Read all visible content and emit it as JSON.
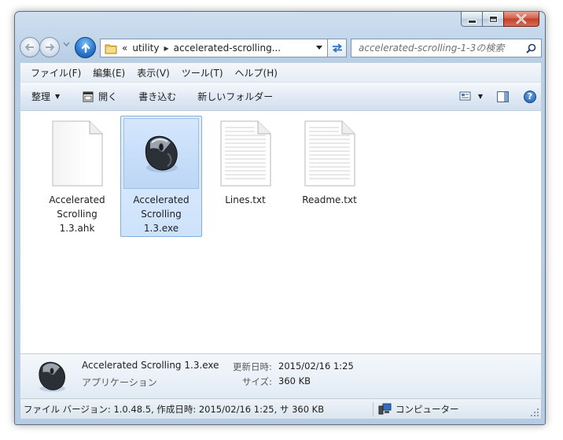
{
  "navigation": {
    "address_segments": [
      "«",
      "utility",
      "accelerated-scrolling..."
    ],
    "search_placeholder": "accelerated-scrolling-1-3の検索"
  },
  "menu": {
    "items": [
      "ファイル(F)",
      "編集(E)",
      "表示(V)",
      "ツール(T)",
      "ヘルプ(H)"
    ]
  },
  "toolbar": {
    "organize": "整理",
    "open": "開く",
    "write": "書き込む",
    "new_folder": "新しいフォルダー"
  },
  "files": [
    {
      "label": "Accelerated Scrolling 1.3.ahk",
      "icon": "blank-document-icon",
      "selected": false
    },
    {
      "label": "Accelerated Scrolling 1.3.exe",
      "icon": "mouse-app-icon",
      "selected": true
    },
    {
      "label": "Lines.txt",
      "icon": "text-document-icon",
      "selected": false
    },
    {
      "label": "Readme.txt",
      "icon": "text-document-icon",
      "selected": false
    }
  ],
  "details": {
    "name": "Accelerated Scrolling 1.3.exe",
    "type": "アプリケーション",
    "modified_label": "更新日時:",
    "modified_value": "2015/02/16 1:25",
    "size_label": "サイズ:",
    "size_value": "360 KB"
  },
  "status": {
    "text": "ファイル バージョン: 1.0.48.5, 作成日時: 2015/02/16 1:25, サ 360 KB",
    "zone": "コンピューター"
  },
  "colors": {
    "selection_fill": "#cde2fb",
    "selection_border": "#84acdd",
    "close_button": "#c3412c"
  }
}
